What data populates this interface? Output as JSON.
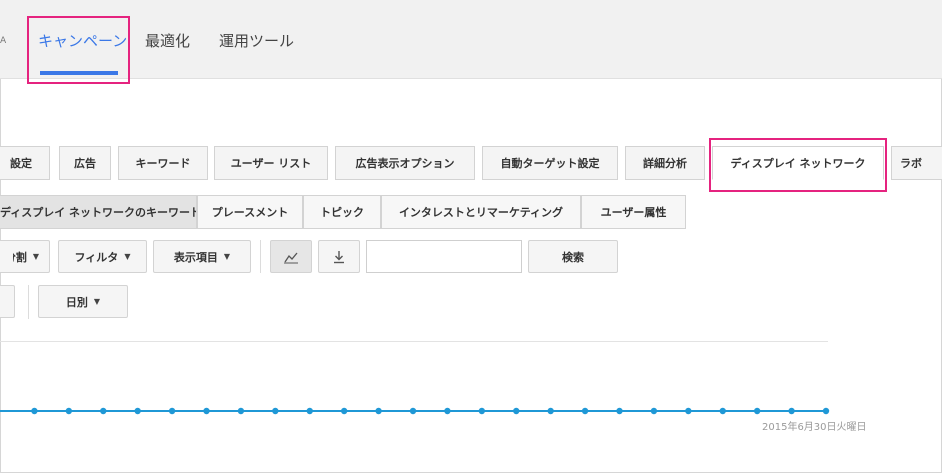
{
  "topnav": {
    "cut_label": "A",
    "tabs": [
      {
        "label": "キャンペーン"
      },
      {
        "label": "最適化"
      },
      {
        "label": "運用ツール"
      }
    ]
  },
  "tabs": [
    {
      "label": "設定"
    },
    {
      "label": "広告"
    },
    {
      "label": "キーワード"
    },
    {
      "label": "ユーザー リスト"
    },
    {
      "label": "広告表示オプション"
    },
    {
      "label": "自動ターゲット設定"
    },
    {
      "label": "詳細分析"
    },
    {
      "label": "ディスプレイ ネットワーク"
    },
    {
      "label": "ラボ"
    }
  ],
  "subtabs": [
    {
      "label": "ディスプレイ ネットワークのキーワード"
    },
    {
      "label": "プレースメント"
    },
    {
      "label": "トピック"
    },
    {
      "label": "インタレストとリマーケティング"
    },
    {
      "label": "ユーザー属性"
    }
  ],
  "toolbar": {
    "segment_label": "分割",
    "filter_label": "フィルタ",
    "columns_label": "表示項目",
    "search_value": "",
    "search_button_label": "検索",
    "period_label": "日別"
  },
  "icons": {
    "chart": "chart-line-icon",
    "download": "download-icon",
    "caret": "chevron-down-icon"
  },
  "colors": {
    "accent": "#3b78e7",
    "highlight": "#e5237f",
    "series": "#1f98d6"
  },
  "chart_data": {
    "type": "line",
    "series": [
      {
        "values": [
          0,
          0,
          0,
          0,
          0,
          0,
          0,
          0,
          0,
          0,
          0,
          0,
          0,
          0,
          0,
          0,
          0,
          0,
          0,
          0,
          0,
          0,
          0,
          0,
          0
        ]
      }
    ],
    "x_end_label": "2015年6月30日火曜日"
  }
}
